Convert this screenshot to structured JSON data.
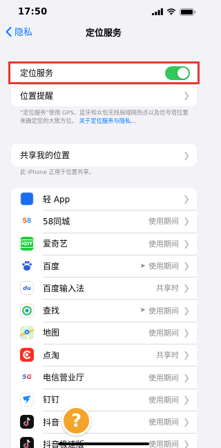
{
  "status_bar": {
    "time": "17:50"
  },
  "nav": {
    "back_label": "隐私",
    "title": "定位服务"
  },
  "location_group": {
    "toggle_label": "定位服务",
    "toggle_on": true,
    "alerts_label": "位置提醒"
  },
  "footnote": {
    "text": "“定位服务”使用 GPS、蓝牙和众包无线局域网热点以及信号塔位置来确定您的大致方位。",
    "link": "关于定位服务与隐私..."
  },
  "share_group": {
    "label": "共享我的位置",
    "note": "此 iPhone 正用于位置共享。"
  },
  "apps": [
    {
      "name": "轻 App",
      "value": "",
      "arrow": false,
      "icon": "light-app-icon"
    },
    {
      "name": "58同城",
      "value": "使用期间",
      "arrow": false,
      "icon": "58-icon"
    },
    {
      "name": "爱奇艺",
      "value": "使用期间",
      "arrow": false,
      "icon": "iqiyi-icon"
    },
    {
      "name": "百度",
      "value": "使用期间",
      "arrow": true,
      "icon": "baidu-icon"
    },
    {
      "name": "百度输入法",
      "value": "共享时",
      "arrow": false,
      "icon": "baidu-ime-icon"
    },
    {
      "name": "查找",
      "value": "使用期间",
      "arrow": true,
      "icon": "find-my-icon"
    },
    {
      "name": "地图",
      "value": "使用期间",
      "arrow": false,
      "icon": "maps-icon"
    },
    {
      "name": "点淘",
      "value": "共享时",
      "arrow": false,
      "icon": "diantao-icon"
    },
    {
      "name": "电信营业厅",
      "value": "使用期间",
      "arrow": false,
      "icon": "5g-telecom-icon"
    },
    {
      "name": "钉钉",
      "value": "使用期间",
      "arrow": false,
      "icon": "dingtalk-icon"
    },
    {
      "name": "抖音",
      "value": "使用期间",
      "arrow": false,
      "icon": "douyin-icon"
    },
    {
      "name": "抖音极速版",
      "value": "使用期间",
      "arrow": false,
      "icon": "douyin-lite-icon"
    }
  ],
  "colors": {
    "accent": "#007aff",
    "toggle_on": "#34c759",
    "highlight": "#e8392e"
  },
  "float_button": {
    "glyph": "?"
  }
}
